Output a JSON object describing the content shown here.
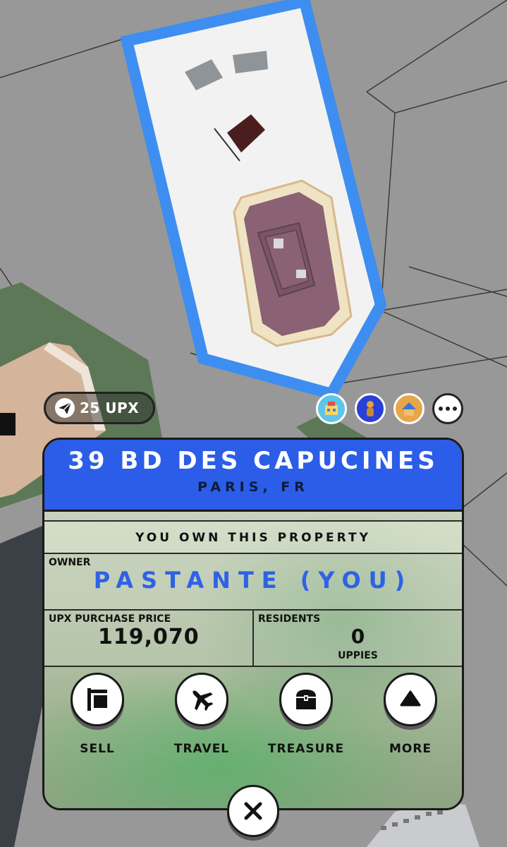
{
  "travel_chip": {
    "label": "25 UPX",
    "icon": "paper-plane-icon"
  },
  "collaborators": [
    {
      "icon": "avatar-building-icon"
    },
    {
      "icon": "avatar-character-icon"
    },
    {
      "icon": "avatar-house-icon"
    }
  ],
  "more_icon": "more-dots-icon",
  "property": {
    "address": "39 BD DES CAPUCINES",
    "city": "PARIS, FR",
    "ownership_status": "YOU OWN THIS PROPERTY",
    "owner_label": "OWNER",
    "owner_name": "PASTANTE (YOU)",
    "price_label": "UPX PURCHASE PRICE",
    "price_value": "119,070",
    "residents_label": "RESIDENTS",
    "residents_value": "0",
    "residents_unit": "UPPIES"
  },
  "actions": [
    {
      "label": "SELL",
      "icon": "sign-icon"
    },
    {
      "label": "TRAVEL",
      "icon": "airplane-icon"
    },
    {
      "label": "TREASURE",
      "icon": "treasure-chest-icon"
    },
    {
      "label": "MORE",
      "icon": "triangle-up-icon"
    }
  ],
  "close_icon": "close-icon",
  "colors": {
    "header_blue": "#2b5de8",
    "owner_blue": "#2e62e6",
    "parcel_outline": "#3d8ef0"
  }
}
